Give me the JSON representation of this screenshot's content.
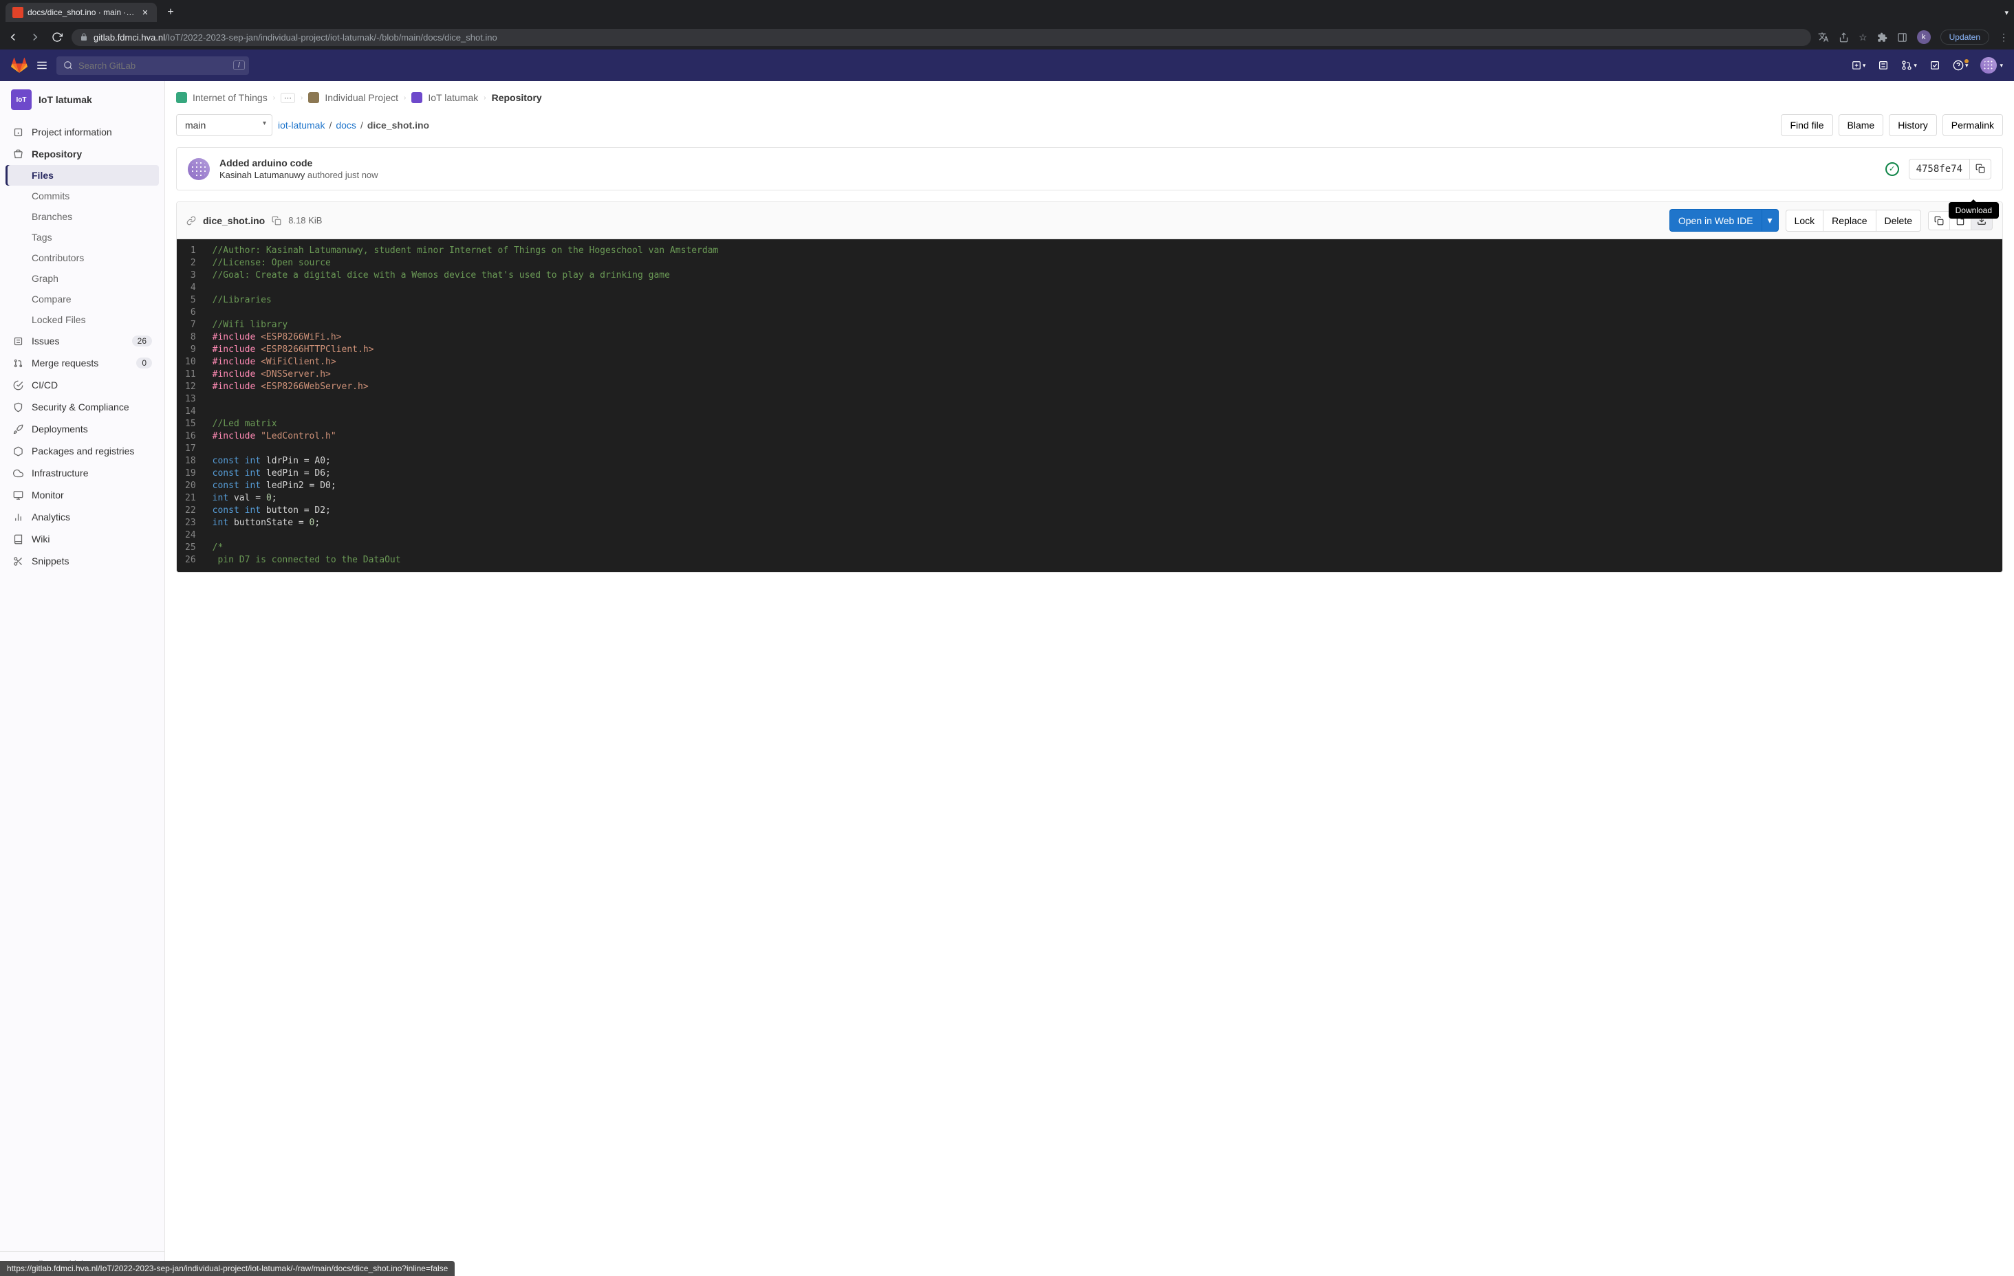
{
  "browser": {
    "tab_title": "docs/dice_shot.ino · main · Int...",
    "url_host": "gitlab.fdmci.hva.nl",
    "url_path": "/IoT/2022-2023-sep-jan/individual-project/iot-latumak/-/blob/main/docs/dice_shot.ino",
    "update_btn": "Updaten",
    "avatar_letter": "k"
  },
  "header": {
    "search_placeholder": "Search GitLab",
    "search_key": "/"
  },
  "sidebar": {
    "project_name": "IoT latumak",
    "project_avatar_text": "IoT",
    "items": {
      "project_info": "Project information",
      "repository": "Repository",
      "issues": "Issues",
      "issues_count": "26",
      "merge_requests": "Merge requests",
      "mr_count": "0",
      "cicd": "CI/CD",
      "security": "Security & Compliance",
      "deployments": "Deployments",
      "packages": "Packages and registries",
      "infrastructure": "Infrastructure",
      "monitor": "Monitor",
      "analytics": "Analytics",
      "wiki": "Wiki",
      "snippets": "Snippets"
    },
    "repo_sub": {
      "files": "Files",
      "commits": "Commits",
      "branches": "Branches",
      "tags": "Tags",
      "contributors": "Contributors",
      "graph": "Graph",
      "compare": "Compare",
      "locked": "Locked Files"
    },
    "collapse": "Collapse sidebar"
  },
  "breadcrumb": {
    "l1": "Internet of Things",
    "l2": "Individual Project",
    "l3": "IoT latumak",
    "l4": "Repository"
  },
  "file_area": {
    "branch": "main",
    "path1": "iot-latumak",
    "path2": "docs",
    "path3": "dice_shot.ino",
    "find_file": "Find file",
    "blame": "Blame",
    "history": "History",
    "permalink": "Permalink"
  },
  "commit": {
    "title": "Added arduino code",
    "author": "Kasinah Latumanuwy",
    "action": " authored ",
    "time": "just now",
    "sha": "4758fe74"
  },
  "file_header": {
    "name": "dice_shot.ino",
    "size": "8.18 KiB",
    "open_ide": "Open in Web IDE",
    "lock": "Lock",
    "replace": "Replace",
    "delete": "Delete",
    "tooltip": "Download"
  },
  "code": {
    "lines": [
      {
        "n": 1,
        "html": "<span class='c-comment'>//Author: Kasinah Latumanuwy, student minor Internet of Things on the Hogeschool van Amsterdam</span>"
      },
      {
        "n": 2,
        "html": "<span class='c-comment'>//License: Open source</span>"
      },
      {
        "n": 3,
        "html": "<span class='c-comment'>//Goal: Create a digital dice with a Wemos device that's used to play a drinking game</span>"
      },
      {
        "n": 4,
        "html": ""
      },
      {
        "n": 5,
        "html": "<span class='c-comment'>//Libraries</span>"
      },
      {
        "n": 6,
        "html": ""
      },
      {
        "n": 7,
        "html": "<span class='c-comment'>//Wifi library</span>"
      },
      {
        "n": 8,
        "html": "<span class='c-pink'>#include</span> <span class='c-string'>&lt;ESP8266WiFi.h&gt;</span>"
      },
      {
        "n": 9,
        "html": "<span class='c-pink'>#include</span> <span class='c-string'>&lt;ESP8266HTTPClient.h&gt;</span>"
      },
      {
        "n": 10,
        "html": "<span class='c-pink'>#include</span> <span class='c-string'>&lt;WiFiClient.h&gt;</span>"
      },
      {
        "n": 11,
        "html": "<span class='c-pink'>#include</span> <span class='c-string'>&lt;DNSServer.h&gt;</span>"
      },
      {
        "n": 12,
        "html": "<span class='c-pink'>#include</span> <span class='c-string'>&lt;ESP8266WebServer.h&gt;</span>"
      },
      {
        "n": 13,
        "html": ""
      },
      {
        "n": 14,
        "html": ""
      },
      {
        "n": 15,
        "html": "<span class='c-comment'>//Led matrix</span>"
      },
      {
        "n": 16,
        "html": "<span class='c-pink'>#include</span> <span class='c-string'>\"LedControl.h\"</span>"
      },
      {
        "n": 17,
        "html": ""
      },
      {
        "n": 18,
        "html": "<span class='c-type'>const</span> <span class='c-type'>int</span> ldrPin = A0;"
      },
      {
        "n": 19,
        "html": "<span class='c-type'>const</span> <span class='c-type'>int</span> ledPin = D6;"
      },
      {
        "n": 20,
        "html": "<span class='c-type'>const</span> <span class='c-type'>int</span> ledPin2 = D0;"
      },
      {
        "n": 21,
        "html": "<span class='c-type'>int</span> val = <span class='c-number'>0</span>;"
      },
      {
        "n": 22,
        "html": "<span class='c-type'>const</span> <span class='c-type'>int</span> button = D2;"
      },
      {
        "n": 23,
        "html": "<span class='c-type'>int</span> buttonState = <span class='c-number'>0</span>;"
      },
      {
        "n": 24,
        "html": ""
      },
      {
        "n": 25,
        "html": "<span class='c-comment'>/*</span>"
      },
      {
        "n": 26,
        "html": "<span class='c-comment'> pin D7 is connected to the DataOut</span>"
      }
    ]
  },
  "status_url": "https://gitlab.fdmci.hva.nl/IoT/2022-2023-sep-jan/individual-project/iot-latumak/-/raw/main/docs/dice_shot.ino?inline=false"
}
